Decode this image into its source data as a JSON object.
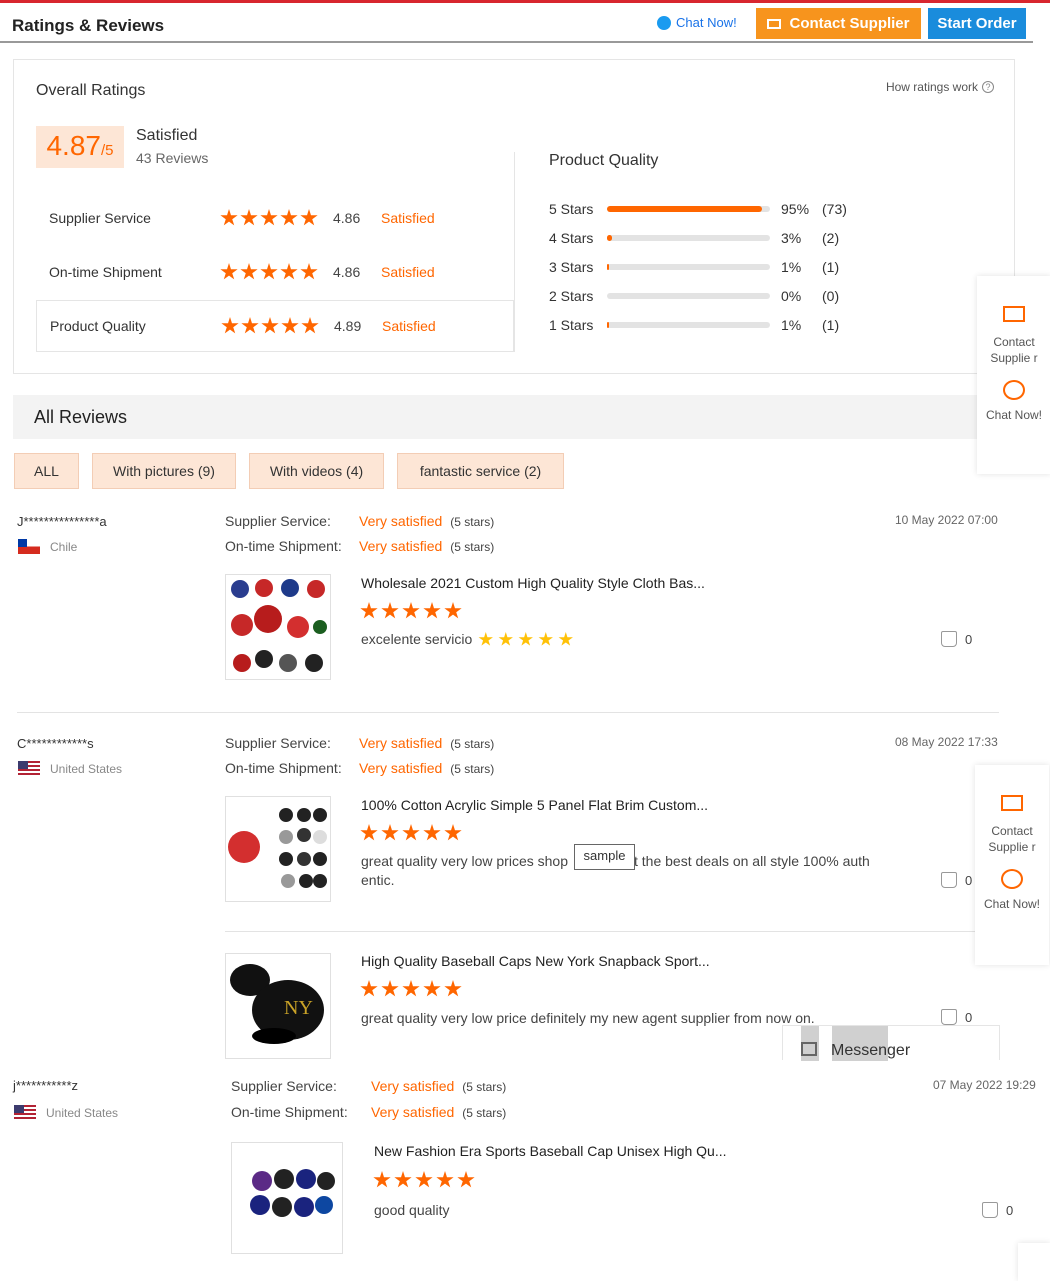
{
  "header": {
    "title": "Ratings & Reviews",
    "chat_now": "Chat Now!",
    "contact_supplier": "Contact Supplier",
    "start_order": "Start Order"
  },
  "overall": {
    "title": "Overall Ratings",
    "how_ratings_work": "How ratings work",
    "score": "4.87",
    "score_suffix": "/5",
    "satisfied": "Satisfied",
    "reviews": "43 Reviews",
    "rows": [
      {
        "label": "Supplier Service",
        "value": "4.86",
        "status": "Satisfied",
        "stars": 5
      },
      {
        "label": "On-time Shipment",
        "value": "4.86",
        "status": "Satisfied",
        "stars": 5
      },
      {
        "label": "Product Quality",
        "value": "4.89",
        "status": "Satisfied",
        "stars": 5
      }
    ]
  },
  "product_quality": {
    "title": "Product Quality",
    "bars": [
      {
        "label": "5  Stars",
        "percent": "95%",
        "count": "(73)",
        "fill": 0.95
      },
      {
        "label": "4  Stars",
        "percent": "3%",
        "count": "(2)",
        "fill": 0.03
      },
      {
        "label": "3  Stars",
        "percent": "1%",
        "count": "(1)",
        "fill": 0.01
      },
      {
        "label": "2  Stars",
        "percent": "0%",
        "count": "(0)",
        "fill": 0
      },
      {
        "label": "1  Stars",
        "percent": "1%",
        "count": "(1)",
        "fill": 0.01
      }
    ]
  },
  "all_reviews": {
    "title": "All Reviews",
    "filters": [
      "ALL",
      "With pictures (9)",
      "With videos (4)",
      "fantastic service (2)"
    ]
  },
  "reviews": [
    {
      "name": "J***************a",
      "country": "Chile",
      "date": "10 May 2022 07:00",
      "supplier_service_label": "Supplier Service:",
      "supplier_service": "Very satisfied",
      "supplier_service_stars": "(5 stars)",
      "shipment_label": "On-time Shipment:",
      "shipment": "Very satisfied",
      "shipment_stars": "(5 stars)",
      "products": [
        {
          "title": "Wholesale 2021 Custom High Quality Style Cloth Bas...",
          "comment": "excelente servicio",
          "likes": "0"
        }
      ]
    },
    {
      "name": "C************s",
      "country": "United States",
      "date": "08 May 2022 17:33",
      "supplier_service_label": "Supplier Service:",
      "supplier_service": "Very satisfied",
      "supplier_service_stars": "(5 stars)",
      "shipment_label": "On-time Shipment:",
      "shipment": "Very satisfied",
      "shipment_stars": "(5 stars)",
      "products": [
        {
          "title": "100% Cotton Acrylic Simple 5 Panel Flat Brim Custom...",
          "comment_a": "great quality very low prices shop",
          "comment_b": "t the best deals on all style 100% auth",
          "comment_c": "entic.",
          "likes": "0"
        },
        {
          "title": "High Quality Baseball Caps New York Snapback Sport...",
          "comment": "great quality very low price definitely my new agent supplier from now on.",
          "likes": "0"
        }
      ]
    },
    {
      "name": "j***********z",
      "country": "United States",
      "date": "07 May 2022 19:29",
      "supplier_service_label": "Supplier Service:",
      "supplier_service": "Very satisfied",
      "supplier_service_stars": "(5 stars)",
      "shipment_label": "On-time Shipment:",
      "shipment": "Very satisfied",
      "shipment_stars": "(5 stars)",
      "products": [
        {
          "title": "New Fashion Era Sports Baseball Cap Unisex High Qu...",
          "comment": "good quality",
          "likes": "0"
        }
      ]
    }
  ],
  "side_widget": {
    "contact": "Contact Supplie r",
    "chat": "Chat Now!"
  },
  "tooltip": "sample",
  "messenger": "Messenger"
}
